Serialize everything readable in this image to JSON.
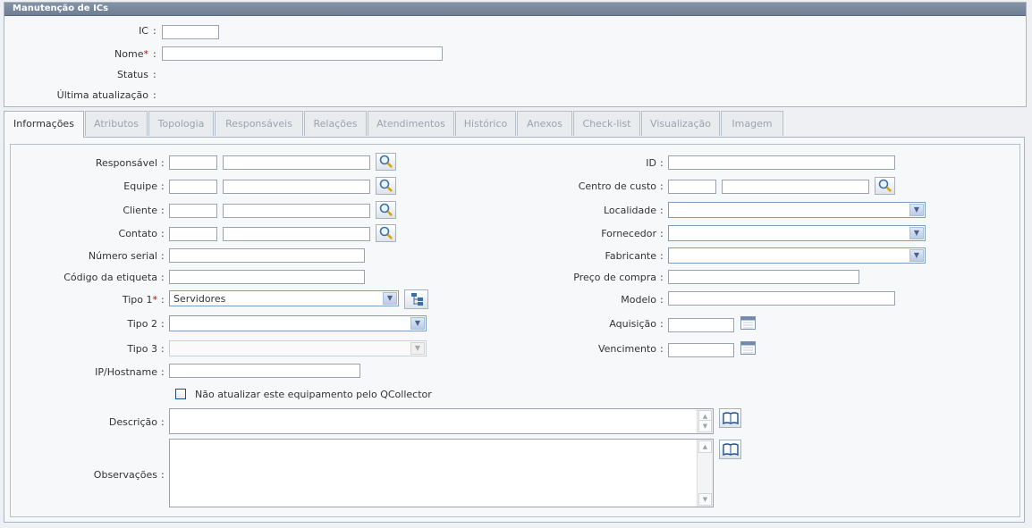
{
  "panel": {
    "title": "Manutenção de ICs",
    "fields": {
      "ic_label": "IC",
      "nome_label": "Nome",
      "status_label": "Status",
      "ultima_label": "Última atualização"
    },
    "required_mark": "*",
    "colon": ":"
  },
  "tabs": [
    "Informações",
    "Atributos",
    "Topologia",
    "Responsáveis",
    "Relações",
    "Atendimentos",
    "Histórico",
    "Anexos",
    "Check-list",
    "Visualização",
    "Imagem"
  ],
  "form": {
    "left": {
      "responsavel": "Responsável",
      "equipe": "Equipe",
      "cliente": "Cliente",
      "contato": "Contato",
      "numero_serial": "Número serial",
      "codigo_etiqueta": "Código da etiqueta",
      "tipo1": "Tipo 1",
      "tipo1_value": "Servidores",
      "tipo2": "Tipo 2",
      "tipo3": "Tipo 3",
      "ip": "IP/Hostname",
      "checkbox": "Não atualizar este equipamento pelo QCollector",
      "descricao": "Descrição",
      "observacoes": "Observações"
    },
    "right": {
      "id": "ID",
      "centro_custo": "Centro de custo",
      "localidade": "Localidade",
      "fornecedor": "Fornecedor",
      "fabricante": "Fabricante",
      "preco": "Preço de compra",
      "modelo": "Modelo",
      "aquisicao": "Aquisição",
      "vencimento": "Vencimento"
    }
  },
  "colors": {
    "header": "#7a889c",
    "required": "#d00000",
    "accent": "#3b6ea5"
  }
}
